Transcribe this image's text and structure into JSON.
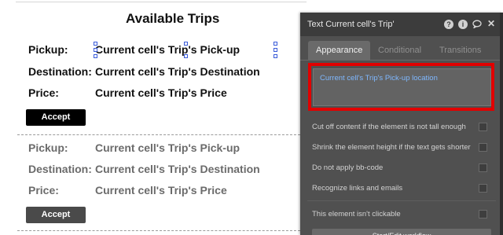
{
  "canvas": {
    "title": "Available Trips",
    "cells": [
      {
        "pickup_label": "Pickup:",
        "pickup_value": "Current cell's Trip's Pick-up",
        "destination_label": "Destination:",
        "destination_value": "Current cell's Trip's Destination",
        "price_label": "Price:",
        "price_value": "Current cell's Trip's Price",
        "button_label": "Accept"
      },
      {
        "pickup_label": "Pickup:",
        "pickup_value": "Current cell's Trip's Pick-up",
        "destination_label": "Destination:",
        "destination_value": "Current cell's Trip's Destination",
        "price_label": "Price:",
        "price_value": "Current cell's Trip's Price",
        "button_label": "Accept"
      }
    ]
  },
  "panel": {
    "title": "Text Current cell's Trip'",
    "header_icons": [
      "help-icon",
      "info-icon",
      "comment-icon",
      "close-icon"
    ],
    "tabs": [
      "Appearance",
      "Conditional",
      "Transitions"
    ],
    "active_tab": "Appearance",
    "content_value": "Current cell's Trip's Pick-up location",
    "options": [
      "Cut off content if the element is not tall enough",
      "Shrink the element height if the text gets shorter",
      "Do not apply bb-code",
      "Recognize links and emails",
      "This element isn't clickable"
    ],
    "workflow_button": "Start/Edit workflow"
  },
  "colors": {
    "highlight": "#e10000",
    "dynamic_text": "#7fb8ff",
    "panel_bg": "#505050",
    "panel_header_bg": "#3c3c3c"
  }
}
